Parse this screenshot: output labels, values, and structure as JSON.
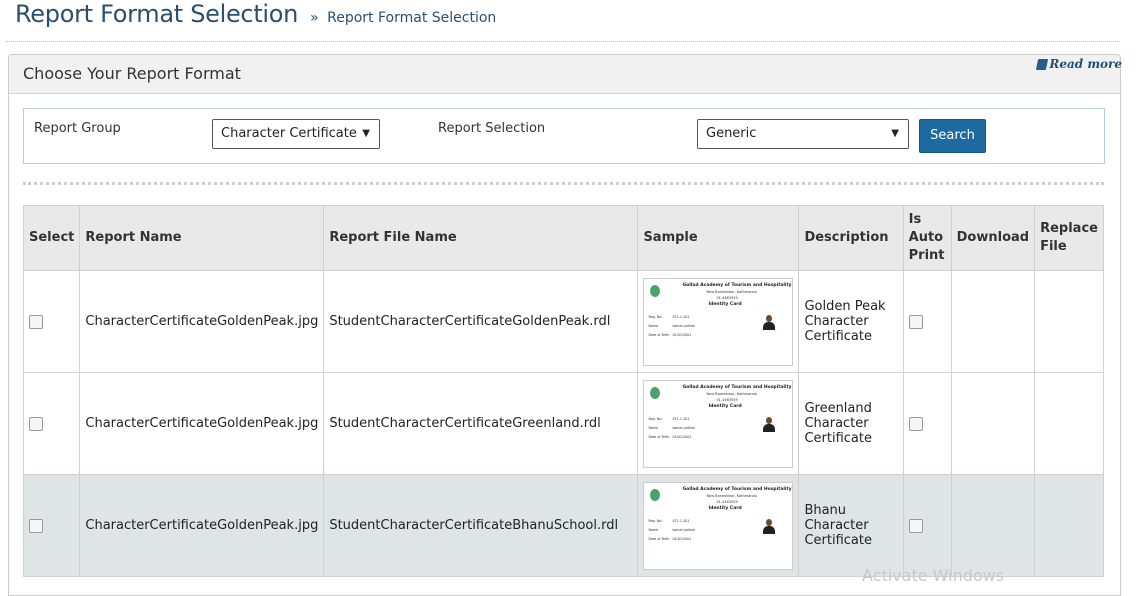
{
  "page": {
    "title": "Report Format Selection",
    "breadcrumb_sep": "»",
    "breadcrumb": "Report Format Selection"
  },
  "panel": {
    "title": "Choose Your Report Format",
    "read_more": "Read more"
  },
  "filters": {
    "report_group_label": "Report Group",
    "report_group_value": "Character Certificate",
    "report_selection_label": "Report Selection",
    "report_selection_value": "Generic",
    "search_label": "Search"
  },
  "table": {
    "headers": [
      "Select",
      "Report Name",
      "Report File Name",
      "Sample",
      "Description",
      "Is Auto Print",
      "Download",
      "Replace File"
    ],
    "rows": [
      {
        "report_name": "CharacterCertificateGoldenPeak.jpg",
        "file_name": "StudentCharacterCertificateGoldenPeak.rdl",
        "description": "Golden Peak Character Certificate"
      },
      {
        "report_name": "CharacterCertificateGoldenPeak.jpg",
        "file_name": "StudentCharacterCertificateGreenland.rdl",
        "description": "Greenland Character Certificate"
      },
      {
        "report_name": "CharacterCertificateGoldenPeak.jpg",
        "file_name": "StudentCharacterCertificateBhanuSchool.rdl",
        "description": "Bhanu Character Certificate"
      }
    ]
  },
  "sample_card": {
    "org": "Gollad Academy of Tourism and Hospitality",
    "address": "New Baneshwor, Kathmandu",
    "phone": "01-4463559",
    "card_title": "Identity Card",
    "reg_label": "Reg. No.:",
    "reg_value": "071-1-201",
    "name_label": "Name",
    "name_value": "kamal pathak",
    "dob_label": "Date of Birth",
    "dob_value": "01/01/2001"
  },
  "watermark": "Activate Windows",
  "colors": {
    "accent": "#1c6aa0",
    "title": "#2b4f6e",
    "alt_row": "#dfe4e6"
  }
}
